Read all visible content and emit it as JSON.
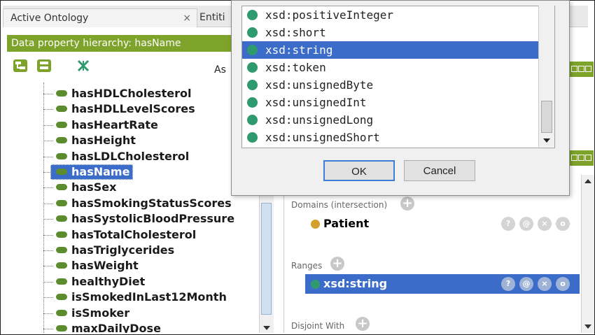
{
  "tabs": {
    "active_label": "Active Ontology",
    "close": "×",
    "second_label": "Entiti"
  },
  "hierarchy": {
    "header": "Data property hierarchy: hasName",
    "asserted_label": "As",
    "items": [
      "hasHDLCholesterol",
      "hasHDLLevelScores",
      "hasHeartRate",
      "hasHeight",
      "hasLDLCholesterol",
      "hasName",
      "hasSex",
      "hasSmokingStatusScores",
      "hasSystolicBloodPressure",
      "hasTotalCholesterol",
      "hasTriglycerides",
      "hasWeight",
      "healthyDiet",
      "isSmokedInLast12Month",
      "isSmoker",
      "maxDailyDose"
    ],
    "selected": "hasName"
  },
  "dialog": {
    "items": [
      "xsd:positiveInteger",
      "xsd:short",
      "xsd:string",
      "xsd:token",
      "xsd:unsignedByte",
      "xsd:unsignedInt",
      "xsd:unsignedLong",
      "xsd:unsignedShort"
    ],
    "selected": "xsd:string",
    "ok_label": "OK",
    "cancel_label": "Cancel"
  },
  "description": {
    "domains_label": "Domains (intersection)",
    "domain_value": "Patient",
    "ranges_label": "Ranges",
    "range_value": "xsd:string",
    "disjoint_label": "Disjoint With",
    "plus": "+",
    "row_buttons": [
      "?",
      "@",
      "×",
      "o"
    ]
  },
  "colors": {
    "header_green": "#7ea32a",
    "selection_blue": "#3b6cc9",
    "datatype_dot": "#2e9a6e",
    "class_dot": "#d4a029",
    "property_pill": "#5b8c2e"
  }
}
